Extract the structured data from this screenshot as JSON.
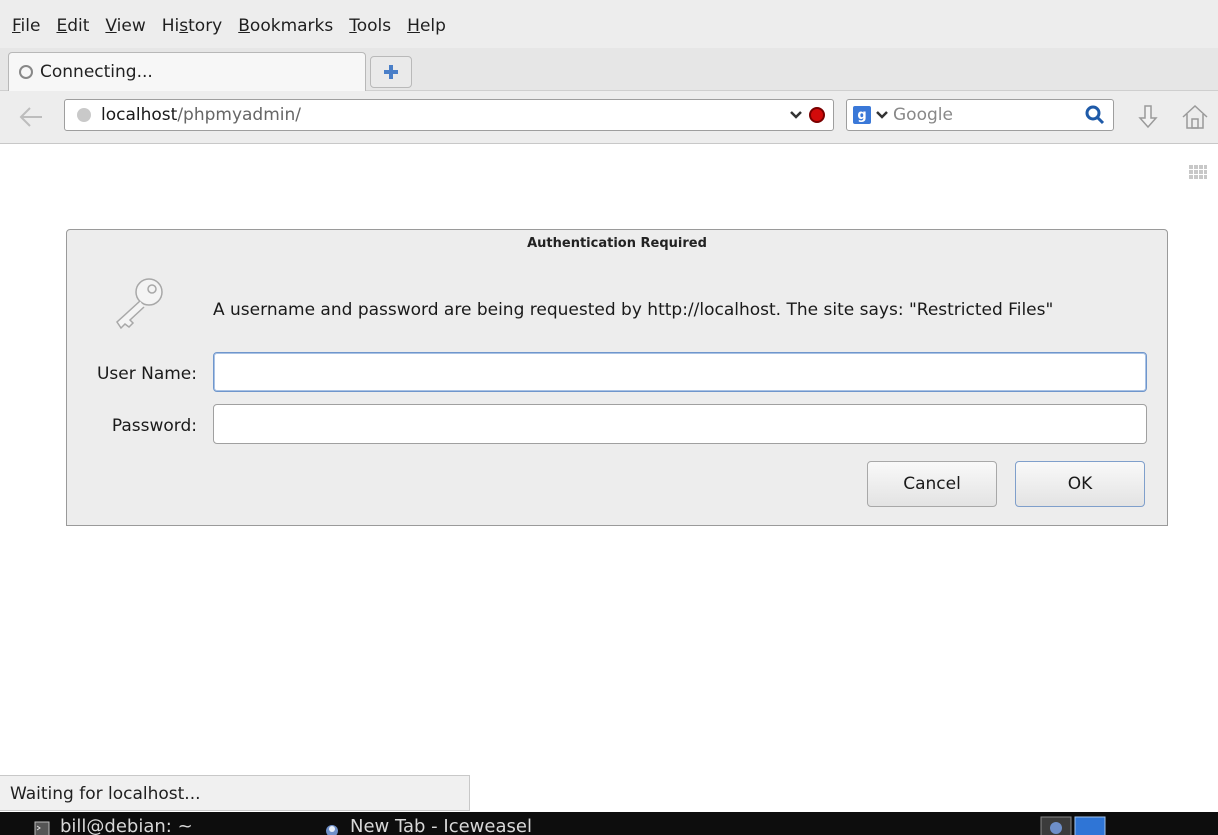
{
  "menubar": {
    "items": [
      {
        "accel": "F",
        "rest": "ile"
      },
      {
        "accel": "E",
        "rest": "dit"
      },
      {
        "accel": "V",
        "rest": "iew"
      },
      {
        "pre": "Hi",
        "accel": "s",
        "rest": "tory"
      },
      {
        "accel": "B",
        "rest": "ookmarks"
      },
      {
        "accel": "T",
        "rest": "ools"
      },
      {
        "accel": "H",
        "rest": "elp"
      }
    ]
  },
  "tabs": [
    {
      "title": "Connecting..."
    }
  ],
  "navbar": {
    "url_host": "localhost",
    "url_path": "/phpmyadmin/",
    "search_placeholder": "Google"
  },
  "dialog": {
    "title": "Authentication Required",
    "message": "A username and password are being requested by http://localhost. The site says: \"Restricted Files\"",
    "username_label": "User Name:",
    "password_label": "Password:",
    "username_value": "",
    "password_value": "",
    "cancel_label": "Cancel",
    "ok_label": "OK"
  },
  "status": {
    "text": "Waiting for localhost..."
  },
  "taskbar": {
    "tasks": [
      {
        "title": "bill@debian: ~"
      },
      {
        "title": "New Tab - Iceweasel"
      }
    ]
  },
  "colors": {
    "stop_button": "#d20a0a",
    "search_engine": "#3a78d8",
    "focus_border": "#6f96cc"
  }
}
